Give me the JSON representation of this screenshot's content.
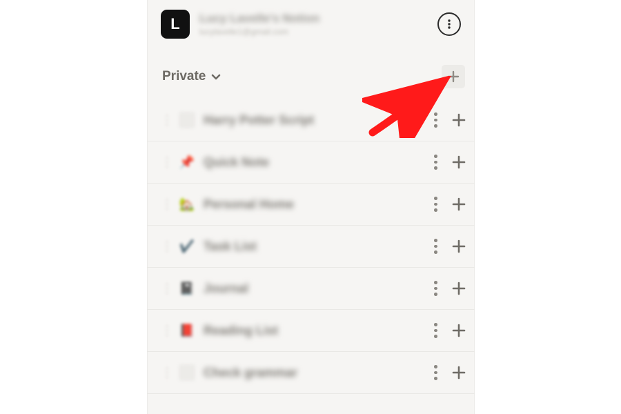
{
  "workspace": {
    "avatar_letter": "L",
    "name": "Lucy Lavelle's Notion",
    "email": "lucylavelle1@gmail.com"
  },
  "section": {
    "label": "Private"
  },
  "pages": [
    {
      "icon": "page",
      "title": "Harry Potter Script"
    },
    {
      "icon": "pin",
      "title": "Quick Note"
    },
    {
      "icon": "home",
      "title": "Personal Home"
    },
    {
      "icon": "check",
      "title": "Task List"
    },
    {
      "icon": "journal",
      "title": "Journal"
    },
    {
      "icon": "book",
      "title": "Reading List"
    },
    {
      "icon": "page",
      "title": "Check grammar"
    }
  ],
  "annotation": {
    "kind": "arrow",
    "color": "#ff1a1a",
    "points_to": "add-page-button"
  }
}
